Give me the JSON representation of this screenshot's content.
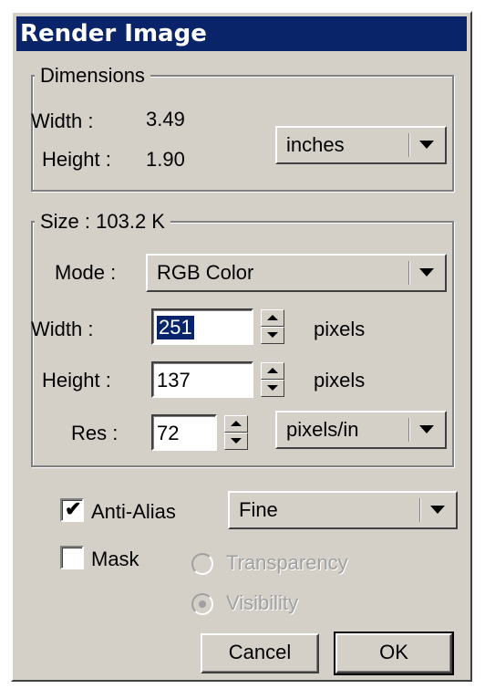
{
  "window": {
    "title": "Render Image"
  },
  "dimensions": {
    "legend": "Dimensions",
    "width_label": "Width :",
    "width_value": "3.49",
    "height_label": "Height :",
    "height_value": "1.90",
    "units": "inches"
  },
  "size": {
    "legend": "Size : 103.2 K",
    "mode_label": "Mode :",
    "mode_value": "RGB Color",
    "width_label": "Width :",
    "width_value": "251",
    "width_unit": "pixels",
    "height_label": "Height :",
    "height_value": "137",
    "height_unit": "pixels",
    "res_label": "Res :",
    "res_value": "72",
    "res_unit": "pixels/in"
  },
  "options": {
    "anti_alias_label": "Anti-Alias",
    "anti_alias_checked": true,
    "anti_alias_value": "Fine",
    "mask_label": "Mask",
    "mask_checked": false,
    "transparency_label": "Transparency",
    "visibility_label": "Visibility",
    "selected_radio": "Visibility"
  },
  "buttons": {
    "cancel": "Cancel",
    "ok": "OK"
  },
  "icons": {
    "dropdown": "chevron-down-icon",
    "spin_up": "arrow-up-icon",
    "spin_down": "arrow-down-icon",
    "check": "checkmark-icon"
  },
  "colors": {
    "titlebar": "#0a246a",
    "face": "#d4d0c8",
    "selection": "#0a246a"
  }
}
